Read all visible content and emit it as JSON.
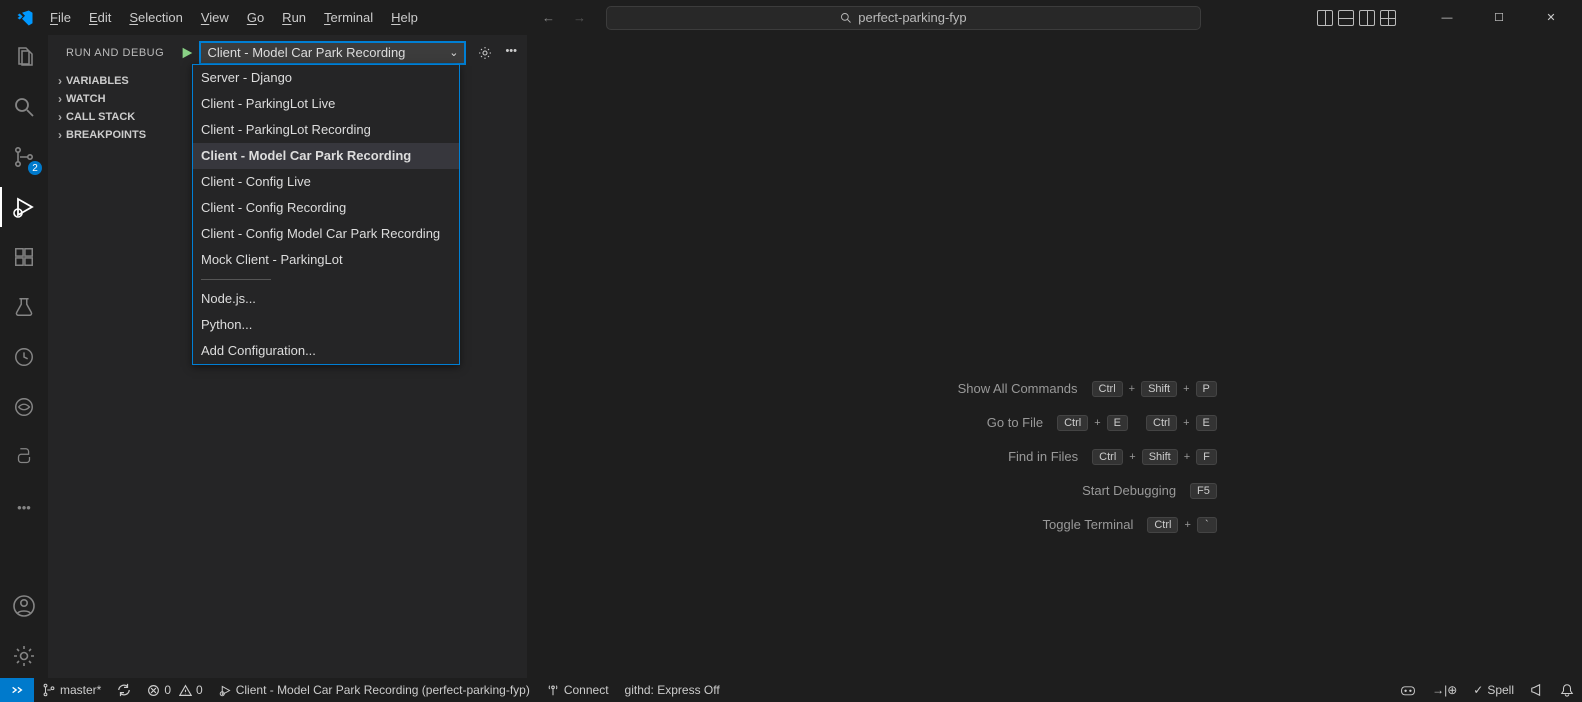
{
  "menu": {
    "items": [
      "File",
      "Edit",
      "Selection",
      "View",
      "Go",
      "Run",
      "Terminal",
      "Help"
    ]
  },
  "search": {
    "text": "perfect-parking-fyp"
  },
  "activitybar": {
    "scm_badge": "2"
  },
  "sidebar": {
    "title": "RUN AND DEBUG",
    "selected_config": "Client - Model Car Park Recording",
    "sections": [
      "VARIABLES",
      "WATCH",
      "CALL STACK",
      "BREAKPOINTS"
    ]
  },
  "dropdown": {
    "configs": [
      "Server - Django",
      "Client - ParkingLot Live",
      "Client - ParkingLot Recording",
      "Client - Model Car Park Recording",
      "Client - Config Live",
      "Client - Config Recording",
      "Client - Config Model Car Park Recording",
      "Mock Client - ParkingLot"
    ],
    "selected_index": 3,
    "extras": [
      "Node.js...",
      "Python...",
      "Add Configuration..."
    ]
  },
  "shortcuts": {
    "rows": [
      {
        "label": "Show All Commands",
        "keys": [
          [
            "Ctrl",
            "+",
            "Shift",
            "+",
            "P"
          ]
        ]
      },
      {
        "label": "Go to File",
        "keys": [
          [
            "Ctrl",
            "+",
            "E"
          ],
          [
            "Ctrl",
            "+",
            "E"
          ]
        ]
      },
      {
        "label": "Find in Files",
        "keys": [
          [
            "Ctrl",
            "+",
            "Shift",
            "+",
            "F"
          ]
        ]
      },
      {
        "label": "Start Debugging",
        "keys": [
          [
            "F5"
          ]
        ]
      },
      {
        "label": "Toggle Terminal",
        "keys": [
          [
            "Ctrl",
            "+",
            "`"
          ]
        ]
      }
    ]
  },
  "statusbar": {
    "branch": "master*",
    "errors": "0",
    "warnings": "0",
    "debug_config": "Client - Model Car Park Recording (perfect-parking-fyp)",
    "connect": "Connect",
    "githd": "githd: Express Off",
    "spell": "Spell"
  }
}
